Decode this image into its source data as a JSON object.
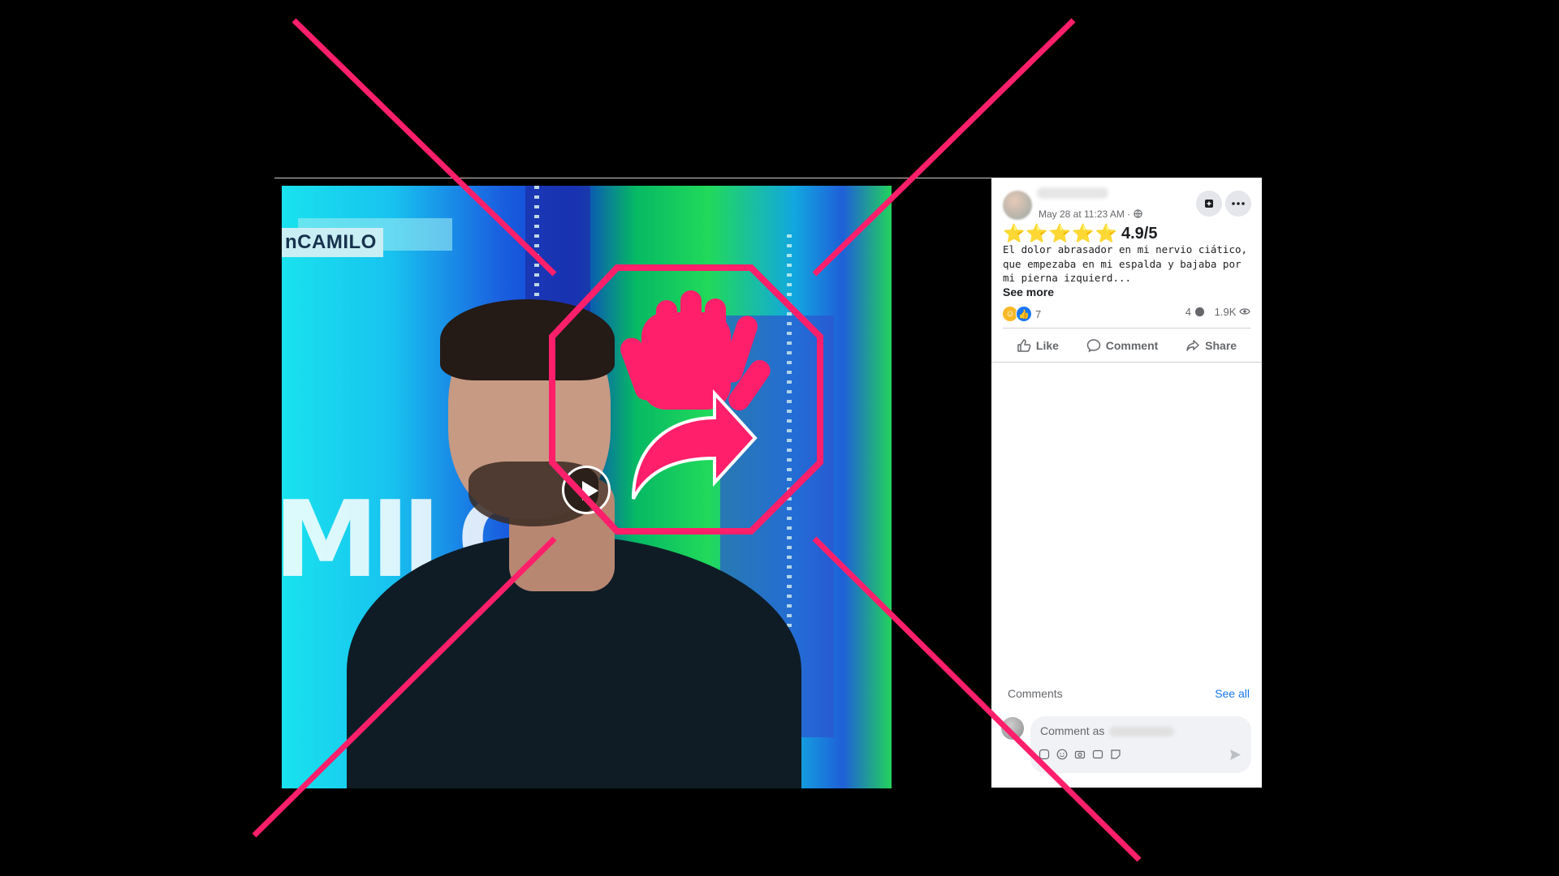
{
  "video": {
    "channel_badge": "nCAMILO",
    "wall_text": "MILO"
  },
  "post": {
    "timestamp": "May 28 at 11:23 AM ·",
    "stars": "⭐⭐⭐⭐⭐",
    "rating": "4.9/5",
    "body": "El dolor abrasador en mi nervio ciático, que empezaba en mi espalda y bajaba por mi pierna izquierd...",
    "see_more": "See more",
    "reaction_count": "7",
    "comment_count": "4",
    "view_count": "1.9K",
    "actions": {
      "like": "Like",
      "comment": "Comment",
      "share": "Share"
    },
    "comments_label": "Comments",
    "see_all": "See all",
    "comment_placeholder": "Comment as"
  },
  "colors": {
    "overlay_pink": "#ff1f6b",
    "facebook_blue": "#1877f2"
  },
  "icons": [
    "play-icon",
    "globe-icon",
    "bookmark-icon",
    "more-icon",
    "haha-reaction-icon",
    "like-reaction-icon",
    "comment-bubble-icon",
    "eye-icon",
    "thumbs-up-icon",
    "comment-icon",
    "share-icon",
    "sticker-icon",
    "emoji-icon",
    "camera-icon",
    "gif-icon",
    "send-icon",
    "stop-hand-icon"
  ]
}
